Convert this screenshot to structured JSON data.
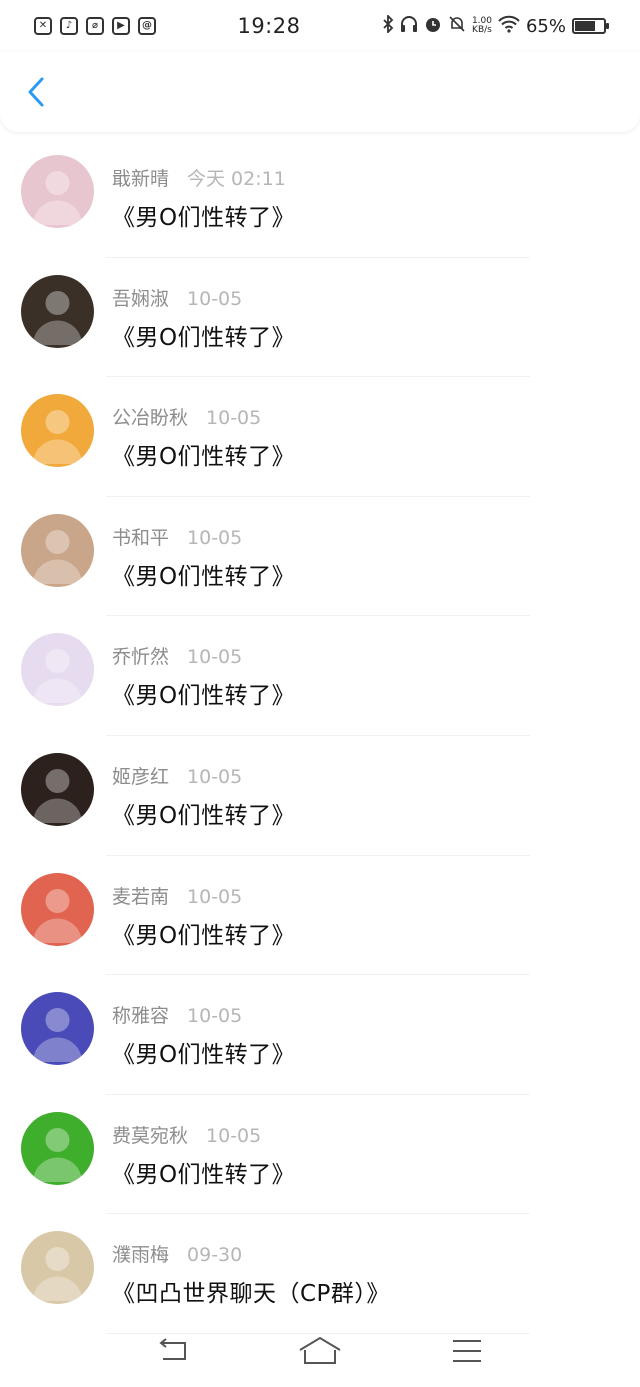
{
  "status_bar": {
    "time": "19:28",
    "battery": "65%",
    "network_speed_value": "1.00",
    "network_speed_unit": "KB/s",
    "app_icons": [
      "✕",
      "♪",
      "⌀",
      "▶",
      "@"
    ],
    "battery_level": 0.65
  },
  "header": {
    "back_icon": "chevron-left-icon",
    "accent_color": "#2b9af3"
  },
  "conversations": [
    {
      "name": "戢新晴",
      "time": "今天 02:11",
      "title": "《男O们性转了》",
      "avatar_color": "#e8c6cf"
    },
    {
      "name": "吾娴淑",
      "time": "10-05",
      "title": "《男O们性转了》",
      "avatar_color": "#3a3028"
    },
    {
      "name": "公冶盼秋",
      "time": "10-05",
      "title": "《男O们性转了》",
      "avatar_color": "#f2a93b"
    },
    {
      "name": "书和平",
      "time": "10-05",
      "title": "《男O们性转了》",
      "avatar_color": "#c9a58a"
    },
    {
      "name": "乔忻然",
      "time": "10-05",
      "title": "《男O们性转了》",
      "avatar_color": "#e7dcef"
    },
    {
      "name": "姬彦红",
      "time": "10-05",
      "title": "《男O们性转了》",
      "avatar_color": "#2c211c"
    },
    {
      "name": "麦若南",
      "time": "10-05",
      "title": "《男O们性转了》",
      "avatar_color": "#e0644f"
    },
    {
      "name": "称雅容",
      "time": "10-05",
      "title": "《男O们性转了》",
      "avatar_color": "#4a4bb8"
    },
    {
      "name": "费莫宛秋",
      "time": "10-05",
      "title": "《男O们性转了》",
      "avatar_color": "#3fae2d"
    },
    {
      "name": "濮雨梅",
      "time": "09-30",
      "title": "《凹凸世界聊天（CP群）》",
      "avatar_color": "#d9c8a8"
    }
  ],
  "navbar": {
    "back_icon": "nav-back-icon",
    "home_icon": "nav-home-icon",
    "menu_icon": "nav-menu-icon"
  }
}
